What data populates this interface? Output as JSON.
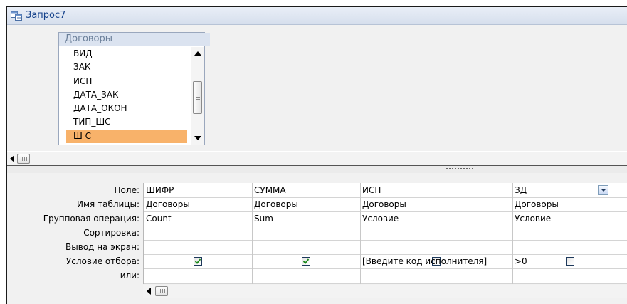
{
  "window": {
    "title": "Запрос7"
  },
  "table": {
    "name": "Договоры",
    "fields": [
      "ВИД",
      "ЗАК",
      "ИСП",
      "ДАТА_ЗАК",
      "ДАТА_ОКОН",
      "ТИП_ШС",
      "Ш С"
    ],
    "selected_index": 6
  },
  "grid": {
    "row_labels": {
      "field": "Поле:",
      "table": "Имя таблицы:",
      "group": "Групповая операция:",
      "sort": "Сортировка:",
      "show": "Вывод на экран:",
      "criteria": "Условие отбора:",
      "or": "или:"
    },
    "columns": [
      {
        "field": "ШИФР",
        "table": "Договоры",
        "group": "Count",
        "sort": "",
        "show": true,
        "criteria": "",
        "or": ""
      },
      {
        "field": "СУММА",
        "table": "Договоры",
        "group": "Sum",
        "sort": "",
        "show": true,
        "criteria": "",
        "or": ""
      },
      {
        "field": "ИСП",
        "table": "Договоры",
        "group": "Условие",
        "sort": "",
        "show": false,
        "criteria": "[Введите код исполнителя]",
        "or": ""
      },
      {
        "field": "ЗД",
        "table": "Договоры",
        "group": "Условие",
        "sort": "",
        "show": false,
        "criteria": ">0",
        "or": ""
      }
    ]
  },
  "colors": {
    "selected_field": "#f8b26a",
    "title_text": "#15428b"
  }
}
